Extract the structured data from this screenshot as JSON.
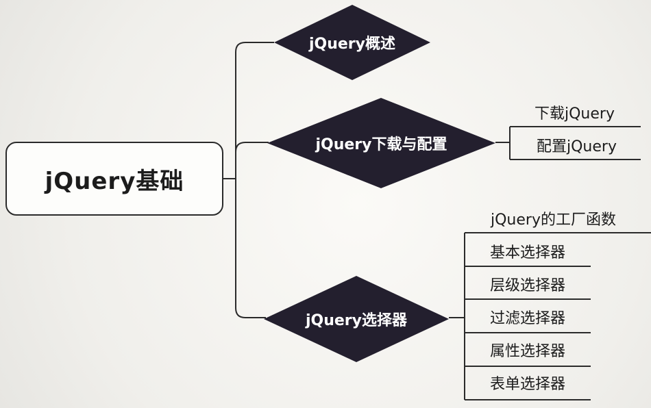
{
  "root": {
    "label": "jQuery基础"
  },
  "branches": [
    {
      "label": "jQuery概述",
      "children": []
    },
    {
      "label": "jQuery下载与配置",
      "children": [
        "下载jQuery",
        "配置jQuery"
      ]
    },
    {
      "label": "jQuery选择器",
      "children": [
        "jQuery的工厂函数",
        "基本选择器",
        "层级选择器",
        "过滤选择器",
        "属性选择器",
        "表单选择器"
      ]
    }
  ],
  "colors": {
    "diamond_fill": "#231f2e",
    "line": "#2a2a2a",
    "root_border": "#2a2a2a"
  }
}
